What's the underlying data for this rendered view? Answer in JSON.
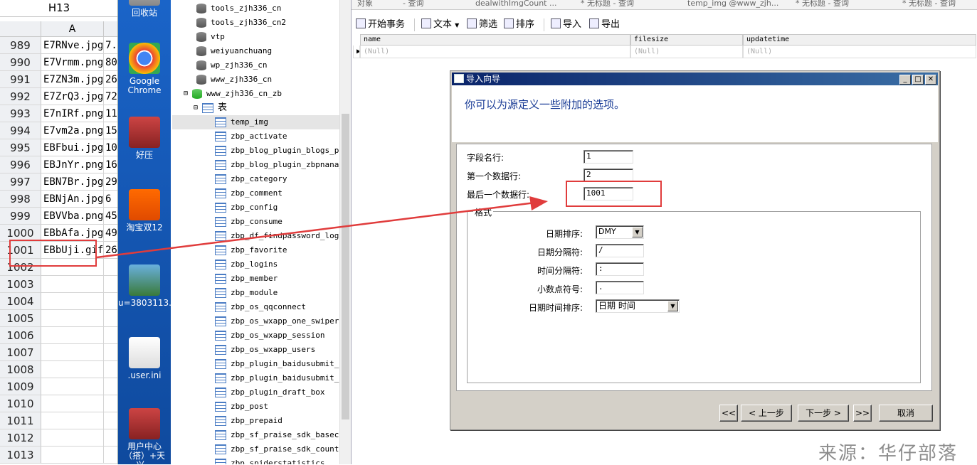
{
  "excel": {
    "namebox": "H13",
    "col_header": "A",
    "rows": [
      {
        "num": "989",
        "a": "E7RNve.jpg",
        "b": "7."
      },
      {
        "num": "990",
        "a": "E7Vrmm.png",
        "b": "80"
      },
      {
        "num": "991",
        "a": "E7ZN3m.jpg",
        "b": "26"
      },
      {
        "num": "992",
        "a": "E7ZrQ3.jpg",
        "b": "72"
      },
      {
        "num": "993",
        "a": "E7nIRf.png",
        "b": "11"
      },
      {
        "num": "994",
        "a": "E7vm2a.png",
        "b": "15"
      },
      {
        "num": "995",
        "a": "EBFbui.jpg",
        "b": "10"
      },
      {
        "num": "996",
        "a": "EBJnYr.png",
        "b": "16"
      },
      {
        "num": "997",
        "a": "EBN7Br.jpg",
        "b": "29"
      },
      {
        "num": "998",
        "a": "EBNjAn.jpg",
        "b": "6"
      },
      {
        "num": "999",
        "a": "EBVVba.png",
        "b": "45"
      },
      {
        "num": "1000",
        "a": "EBbAfa.jpg",
        "b": "49"
      },
      {
        "num": "1001",
        "a": "EBbUji.gif",
        "b": "26"
      },
      {
        "num": "1002",
        "a": "",
        "b": ""
      },
      {
        "num": "1003",
        "a": "",
        "b": ""
      },
      {
        "num": "1004",
        "a": "",
        "b": ""
      },
      {
        "num": "1005",
        "a": "",
        "b": ""
      },
      {
        "num": "1006",
        "a": "",
        "b": ""
      },
      {
        "num": "1007",
        "a": "",
        "b": ""
      },
      {
        "num": "1008",
        "a": "",
        "b": ""
      },
      {
        "num": "1009",
        "a": "",
        "b": ""
      },
      {
        "num": "1010",
        "a": "",
        "b": ""
      },
      {
        "num": "1011",
        "a": "",
        "b": ""
      },
      {
        "num": "1012",
        "a": "",
        "b": ""
      },
      {
        "num": "1013",
        "a": "",
        "b": ""
      }
    ]
  },
  "desktop": {
    "icons": [
      {
        "label": "回收站",
        "icon": "recycle-bin-icon"
      },
      {
        "label": "Google Chrome",
        "icon": "chrome-icon"
      },
      {
        "label": "好压",
        "icon": "haozip-icon"
      },
      {
        "label": "淘宝双12",
        "icon": "taobao-icon"
      },
      {
        "label": "u=3803113...",
        "icon": "image-file-icon"
      },
      {
        "label": ".user.ini",
        "icon": "text-file-icon"
      },
      {
        "label": "用户中心（搭）+天兴...",
        "icon": "archive-icon"
      }
    ]
  },
  "tree": {
    "databases_top": [
      "tools_zjh336_cn",
      "tools_zjh336_cn2",
      "vtp",
      "weiyuanchuang",
      "wp_zjh336_cn",
      "www_zjh336_cn"
    ],
    "open_db": "www_zjh336_cn_zb",
    "tables_node": "表",
    "tables": [
      "temp_img",
      "zbp_activate",
      "zbp_blog_plugin_blogs_pri",
      "zbp_blog_plugin_zbpnana_p",
      "zbp_category",
      "zbp_comment",
      "zbp_config",
      "zbp_consume",
      "zbp_df_findpassword_log",
      "zbp_favorite",
      "zbp_logins",
      "zbp_member",
      "zbp_module",
      "zbp_os_qqconnect",
      "zbp_os_wxapp_one_swiper",
      "zbp_os_wxapp_session",
      "zbp_os_wxapp_users",
      "zbp_plugin_baidusubmit_si",
      "zbp_plugin_baidusubmit_ur",
      "zbp_plugin_draft_box",
      "zbp_post",
      "zbp_prepaid",
      "zbp_sf_praise_sdk_basecou",
      "zbp_sf_praise_sdk_count",
      "zbp_spiderstatistics"
    ]
  },
  "tabs": [
    "对象",
    "- 查询",
    "dealwithImgCount ...",
    "* 无标题 - 查询",
    "temp_img @www_zjh...",
    "* 无标题 - 查询",
    "* 无标题 - 查询"
  ],
  "toolbar": {
    "begin_tx": "开始事务",
    "text": "文本",
    "filter": "筛选",
    "sort": "排序",
    "import": "导入",
    "export": "导出"
  },
  "grid": {
    "columns": [
      "name",
      "filesize",
      "updatetime"
    ],
    "null_text": "(Null)"
  },
  "wizard": {
    "title": "导入向导",
    "heading": "你可以为源定义一些附加的选项。",
    "field_row_label": "字段名行:",
    "field_row_value": "1",
    "first_row_label": "第一个数据行:",
    "first_row_value": "2",
    "last_row_label": "最后一个数据行:",
    "last_row_value": "1001",
    "format_group": "格式",
    "date_order_label": "日期排序:",
    "date_order_value": "DMY",
    "date_sep_label": "日期分隔符:",
    "date_sep_value": "/",
    "time_sep_label": "时间分隔符:",
    "time_sep_value": ":",
    "decimal_label": "小数点符号:",
    "decimal_value": ".",
    "datetime_order_label": "日期时间排序:",
    "datetime_order_value": "日期 时间",
    "btn_first": "<<",
    "btn_prev": "< 上一步",
    "btn_next": "下一步 >",
    "btn_last": ">>",
    "btn_cancel": "取消"
  },
  "watermark": "来源：华仔部落",
  "colors": {
    "annotation": "#e03c3c",
    "title_bar": "#0a246a",
    "heading_text": "#1a3c96"
  }
}
